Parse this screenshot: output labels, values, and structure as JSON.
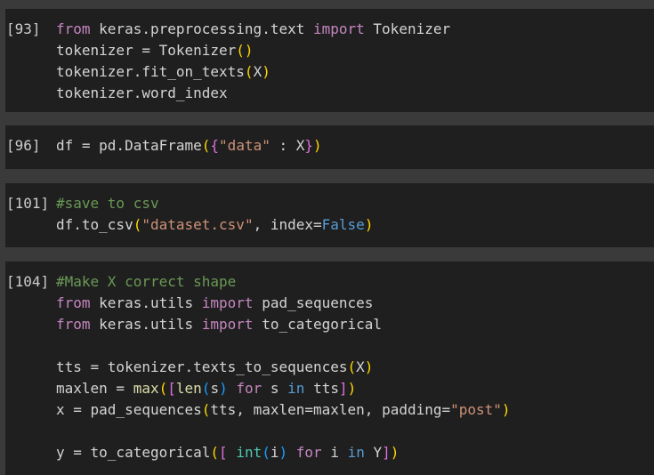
{
  "cells": [
    {
      "prompt": "[93]",
      "lines": [
        [
          [
            "kw",
            "from"
          ],
          [
            "pl",
            " keras.preprocessing.text "
          ],
          [
            "kw",
            "import"
          ],
          [
            "pl",
            " Tokenizer"
          ]
        ],
        [
          [
            "pl",
            "tokenizer = Tokenizer"
          ],
          [
            "b1",
            "()"
          ]
        ],
        [
          [
            "pl",
            "tokenizer.fit_on_texts"
          ],
          [
            "b1",
            "("
          ],
          [
            "pl",
            "X"
          ],
          [
            "b1",
            ")"
          ]
        ],
        [
          [
            "pl",
            "tokenizer.word_index"
          ]
        ]
      ]
    },
    {
      "prompt": "[96]",
      "lines": [
        [
          [
            "pl",
            "df = pd.DataFrame"
          ],
          [
            "b1",
            "("
          ],
          [
            "b2",
            "{"
          ],
          [
            "str",
            "\"data\""
          ],
          [
            "pl",
            " : X"
          ],
          [
            "b2",
            "}"
          ],
          [
            "b1",
            ")"
          ]
        ]
      ]
    },
    {
      "prompt": "[101]",
      "lines": [
        [
          [
            "cm",
            "#save to csv"
          ]
        ],
        [
          [
            "pl",
            "df.to_csv"
          ],
          [
            "b1",
            "("
          ],
          [
            "str",
            "\"dataset.csv\""
          ],
          [
            "pl",
            ", index="
          ],
          [
            "kw2",
            "False"
          ],
          [
            "b1",
            ")"
          ]
        ]
      ]
    },
    {
      "prompt": "[104]",
      "lines": [
        [
          [
            "cm",
            "#Make X correct shape"
          ]
        ],
        [
          [
            "kw",
            "from"
          ],
          [
            "pl",
            " keras.utils "
          ],
          [
            "kw",
            "import"
          ],
          [
            "pl",
            " pad_sequences"
          ]
        ],
        [
          [
            "kw",
            "from"
          ],
          [
            "pl",
            " keras.utils "
          ],
          [
            "kw",
            "import"
          ],
          [
            "pl",
            " to_categorical"
          ]
        ],
        [
          [
            "pl",
            ""
          ]
        ],
        [
          [
            "pl",
            "tts = tokenizer.texts_to_sequences"
          ],
          [
            "b1",
            "("
          ],
          [
            "pl",
            "X"
          ],
          [
            "b1",
            ")"
          ]
        ],
        [
          [
            "pl",
            "maxlen = "
          ],
          [
            "fn",
            "max"
          ],
          [
            "b1",
            "("
          ],
          [
            "b2",
            "["
          ],
          [
            "fn",
            "len"
          ],
          [
            "b3",
            "("
          ],
          [
            "pl",
            "s"
          ],
          [
            "b3",
            ")"
          ],
          [
            "pl",
            " "
          ],
          [
            "kw",
            "for"
          ],
          [
            "pl",
            " s "
          ],
          [
            "kw2",
            "in"
          ],
          [
            "pl",
            " tts"
          ],
          [
            "b2",
            "]"
          ],
          [
            "b1",
            ")"
          ]
        ],
        [
          [
            "pl",
            "x = pad_sequences"
          ],
          [
            "b1",
            "("
          ],
          [
            "pl",
            "tts, maxlen=maxlen, padding="
          ],
          [
            "str",
            "\"post\""
          ],
          [
            "b1",
            ")"
          ]
        ],
        [
          [
            "pl",
            ""
          ]
        ],
        [
          [
            "pl",
            "y = to_categorical"
          ],
          [
            "b1",
            "("
          ],
          [
            "b2",
            "["
          ],
          [
            "pl",
            " "
          ],
          [
            "bi",
            "int"
          ],
          [
            "b3",
            "("
          ],
          [
            "pl",
            "i"
          ],
          [
            "b3",
            ")"
          ],
          [
            "pl",
            " "
          ],
          [
            "kw",
            "for"
          ],
          [
            "pl",
            " i "
          ],
          [
            "kw2",
            "in"
          ],
          [
            "pl",
            " Y"
          ],
          [
            "b2",
            "]"
          ],
          [
            "b1",
            ")"
          ]
        ]
      ]
    }
  ]
}
